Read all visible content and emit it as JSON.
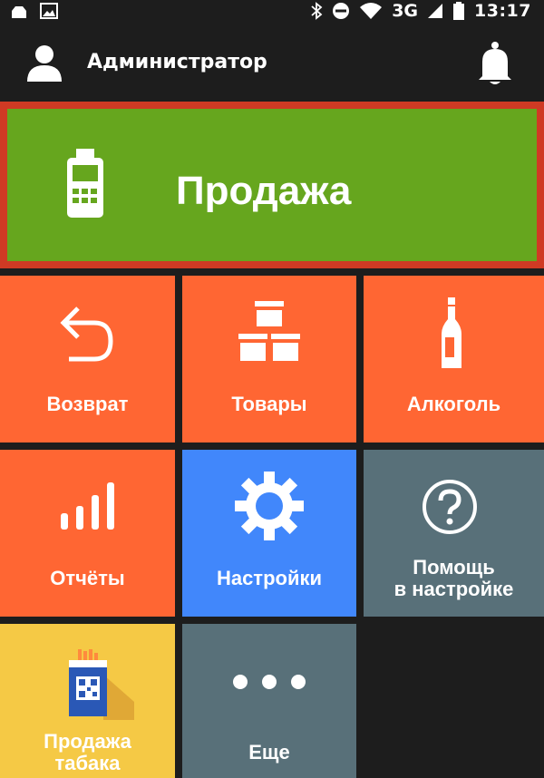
{
  "status_bar": {
    "network": "3G",
    "time": "13:17"
  },
  "header": {
    "user_name": "Администратор"
  },
  "sale": {
    "label": "Продажа"
  },
  "tiles": {
    "returns": "Возврат",
    "goods": "Товары",
    "alcohol": "Алкоголь",
    "reports": "Отчёты",
    "settings": "Настройки",
    "help_line1": "Помощь",
    "help_line2": "в настройке",
    "tobacco_line1": "Продажа",
    "tobacco_line2": "табака",
    "more": "Еще"
  },
  "colors": {
    "sale_green": "#66a61e",
    "selection_red": "#cf3a24",
    "tile_orange": "#ff6633",
    "tile_blue": "#4187fb",
    "tile_slate": "#587079",
    "tile_yellow": "#f5c945",
    "background": "#1d1d1d"
  }
}
